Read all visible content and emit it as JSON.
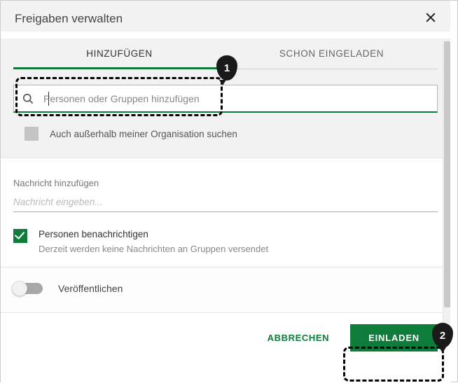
{
  "header": {
    "title": "Freigaben verwalten"
  },
  "tabs": {
    "add": "HINZUFÜGEN",
    "invited": "SCHON EINGELADEN"
  },
  "search": {
    "placeholder": "Personen oder Gruppen hinzufügen",
    "iconName": "search-icon"
  },
  "external_search_label": "Auch außerhalb meiner Organisation suchen",
  "message": {
    "label": "Nachricht hinzufügen",
    "placeholder": "Nachricht eingeben..."
  },
  "notify": {
    "title": "Personen benachrichtigen",
    "note": "Derzeit werden keine Nachrichten an Gruppen versendet",
    "checked": true
  },
  "publish": {
    "label": "Veröffentlichen",
    "on": false
  },
  "footer": {
    "cancel": "ABBRECHEN",
    "invite": "EINLADEN"
  },
  "callouts": {
    "one": "1",
    "two": "2"
  }
}
